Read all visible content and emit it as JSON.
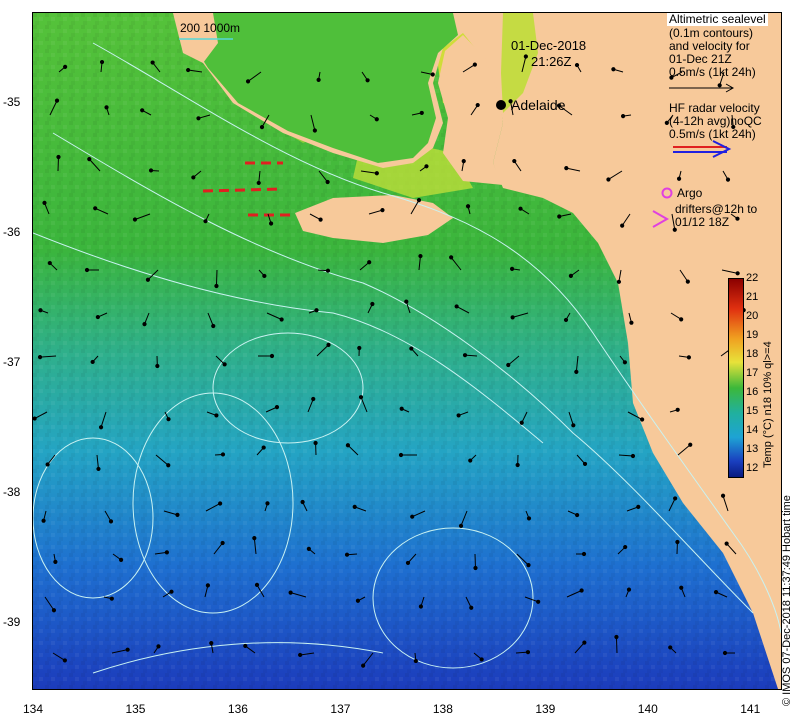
{
  "map": {
    "date": "01-Dec-2018",
    "time": "21:26Z",
    "scale_legend": "200  1000m",
    "city": "Adelaide",
    "colors": {
      "land": "#f7c99a",
      "warm": "#e8e23a",
      "green": "#3cb83a",
      "cool": "#1ea3d4",
      "deep": "#1a3fbf",
      "contour": "#c9f2f2",
      "radar": "#e02020",
      "argo": "#e040e0"
    }
  },
  "axes": {
    "x_ticks": [
      "134",
      "135",
      "136",
      "137",
      "138",
      "139",
      "140",
      "141"
    ],
    "y_ticks": [
      "-35",
      "-36",
      "-37",
      "-38",
      "-39"
    ],
    "x_range": [
      134,
      141.3
    ],
    "y_range": [
      -39.5,
      -34.3
    ]
  },
  "legend": {
    "sealevel": [
      "Altimetric sealevel",
      "(0.1m contours)",
      "and velocity for",
      "01-Dec 21Z",
      "0.5m/s (1kt 24h)"
    ],
    "radar": [
      "HF radar velocity",
      "(4-12h avg)noQC",
      "0.5m/s (1kt 24h)"
    ],
    "argo": "Argo",
    "drifters": [
      "drifters@12h to",
      "01/12 18Z"
    ]
  },
  "colorbar": {
    "title": "Temp (°C) n18 10% ql>=4",
    "ticks": [
      "22",
      "21",
      "20",
      "19",
      "18",
      "17",
      "16",
      "15",
      "14",
      "13",
      "12"
    ],
    "range": [
      12,
      22
    ]
  },
  "copyright": "© IMOS 07-Dec-2018 11:37:49 Hobart time"
}
